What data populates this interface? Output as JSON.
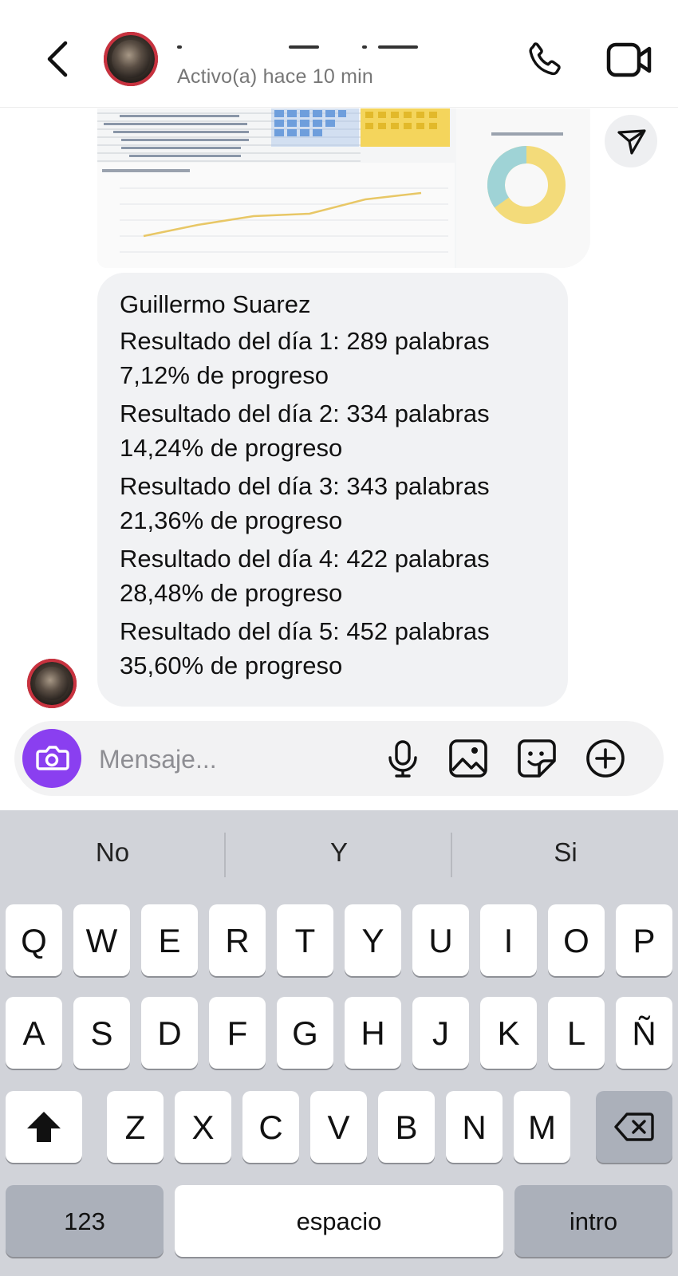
{
  "header": {
    "status": "Activo(a) hace 10 min"
  },
  "message": {
    "sender": "Guillermo Suarez",
    "lines": [
      "Resultado del día 1: 289 palabras",
      "7,12% de progreso",
      "Resultado del día 2: 334 palabras",
      "14,24% de progreso",
      "Resultado del día 3: 343 palabras",
      "21,36% de progreso",
      "Resultado del día 4: 422 palabras",
      "28,48% de progreso",
      "Resultado del día 5: 452 palabras",
      "35,60% de progreso"
    ]
  },
  "composer": {
    "placeholder": "Mensaje..."
  },
  "keyboard": {
    "suggestions": [
      "No",
      "Y",
      "Si"
    ],
    "row1": [
      "Q",
      "W",
      "E",
      "R",
      "T",
      "Y",
      "U",
      "I",
      "O",
      "P"
    ],
    "row2": [
      "A",
      "S",
      "D",
      "F",
      "G",
      "H",
      "J",
      "K",
      "L",
      "Ñ"
    ],
    "row3": [
      "Z",
      "X",
      "C",
      "V",
      "B",
      "N",
      "M"
    ],
    "numbers_label": "123",
    "space_label": "espacio",
    "return_label": "intro"
  },
  "icons": {
    "back": "chevron-left-icon",
    "call": "phone-icon",
    "video": "video-camera-icon",
    "share": "send-icon",
    "camera": "camera-icon",
    "mic": "microphone-icon",
    "gallery": "image-icon",
    "sticker": "sticker-icon",
    "add": "plus-circle-icon",
    "shift": "shift-icon",
    "delete": "backspace-icon"
  },
  "colors": {
    "accent": "#8a3ff0",
    "bubble": "#f1f2f4",
    "keyboard": "#d1d3d9"
  }
}
